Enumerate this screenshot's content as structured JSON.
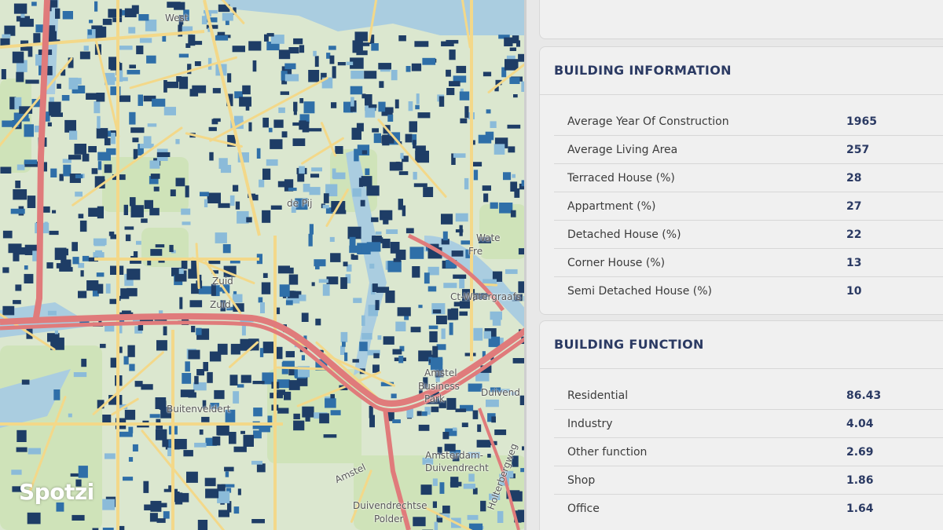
{
  "map": {
    "labels": [
      {
        "text": "West"
      },
      {
        "text": "de Pij"
      },
      {
        "text": "Zuid"
      },
      {
        "text": "Zuid"
      },
      {
        "text": "Buitenveldert"
      },
      {
        "text": "Amstel"
      },
      {
        "text": "Business"
      },
      {
        "text": "Park"
      },
      {
        "text": "Duivend"
      },
      {
        "text": "Amsterdam-"
      },
      {
        "text": "Duivendrecht"
      },
      {
        "text": "Duivendrechtse"
      },
      {
        "text": "Polder"
      },
      {
        "text": "Wate"
      },
      {
        "text": "Fre"
      },
      {
        "text": "Ct-Watergraafs"
      },
      {
        "text": "Amstel"
      },
      {
        "text": "Holterbergweg"
      }
    ],
    "colors": {
      "water": "#aacde0",
      "park": "#cfe3b9",
      "land": "#dbe7cf",
      "road_major": "#e07b7b",
      "road_minor": "#f3d889",
      "building_dark": "#1e3d66",
      "building_mid": "#2f6fa8",
      "building_light": "#8bbbd9"
    }
  },
  "logo": {
    "text": "Spotzi"
  },
  "building_information": {
    "title": "BUILDING INFORMATION",
    "rows": [
      {
        "label": "Average Year Of Construction",
        "value": "1965"
      },
      {
        "label": "Average Living Area",
        "value": "257"
      },
      {
        "label": "Terraced House (%)",
        "value": "28"
      },
      {
        "label": "Appartment (%)",
        "value": "27"
      },
      {
        "label": "Detached House (%)",
        "value": "22"
      },
      {
        "label": "Corner House (%)",
        "value": "13"
      },
      {
        "label": "Semi Detached House (%)",
        "value": "10"
      }
    ]
  },
  "building_function": {
    "title": "BUILDING FUNCTION",
    "rows": [
      {
        "label": "Residential",
        "value": "86.43"
      },
      {
        "label": "Industry",
        "value": "4.04"
      },
      {
        "label": "Other function",
        "value": "2.69"
      },
      {
        "label": "Shop",
        "value": "1.86"
      },
      {
        "label": "Office",
        "value": "1.64"
      }
    ]
  }
}
